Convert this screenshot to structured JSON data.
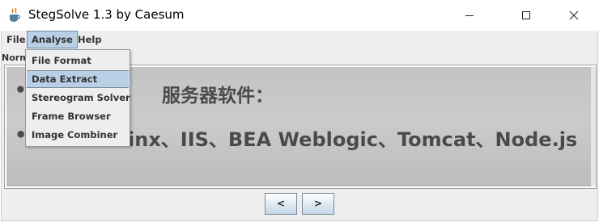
{
  "window": {
    "title": "StegSolve 1.3 by Caesum"
  },
  "menubar": {
    "file": "File",
    "analyse": "Analyse",
    "help": "Help"
  },
  "mode_label": "Norm",
  "analyse_menu": {
    "items": [
      {
        "label": "File Format"
      },
      {
        "label": "Data Extract"
      },
      {
        "label": "Stereogram Solver"
      },
      {
        "label": "Frame Browser"
      },
      {
        "label": "Image Combiner"
      }
    ],
    "selected_index": 1
  },
  "image": {
    "line1": "服务器软件：",
    "line2": "inx、IIS、BEA Weblogic、Tomcat、Node.js"
  },
  "navigation": {
    "prev_label": "<",
    "next_label": ">"
  },
  "colors": {
    "menu_highlight": "#b8cfe5",
    "menu_highlight_border": "#7a8a99",
    "panel_background": "#eeeeee",
    "image_background": "#c3c3c3",
    "image_text": "#4a4a4a"
  }
}
